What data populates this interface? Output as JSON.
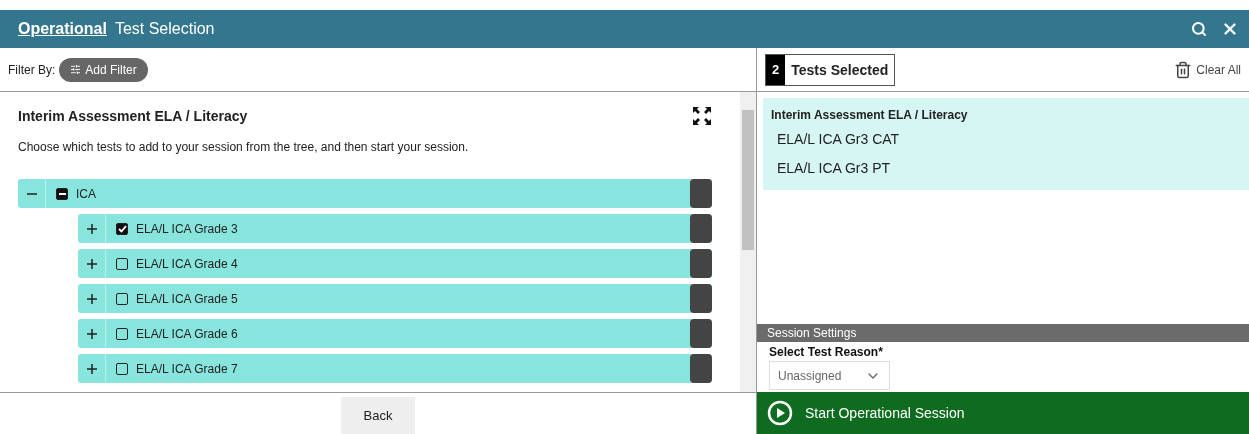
{
  "header": {
    "mode": "Operational",
    "title": "Test Selection"
  },
  "filter": {
    "label": "Filter By:",
    "button": "Add Filter"
  },
  "assessment": {
    "title": "Interim Assessment ELA / Literacy",
    "instructions": "Choose which tests to add to your session from the tree, and then start your session."
  },
  "tree": [
    {
      "label": "ICA",
      "expanded": true,
      "checked": false,
      "indeterminate": true,
      "children": [
        {
          "label": "ELA/L ICA Grade 3",
          "expanded": false,
          "checked": true
        },
        {
          "label": "ELA/L ICA Grade 4",
          "expanded": false,
          "checked": false
        },
        {
          "label": "ELA/L ICA Grade 5",
          "expanded": false,
          "checked": false
        },
        {
          "label": "ELA/L ICA Grade 6",
          "expanded": false,
          "checked": false
        },
        {
          "label": "ELA/L ICA Grade 7",
          "expanded": false,
          "checked": false
        }
      ]
    }
  ],
  "back_button": "Back",
  "selection": {
    "count": "2",
    "label": "Tests Selected",
    "clear": "Clear All",
    "groups": [
      {
        "title": "Interim Assessment ELA / Literacy",
        "tests": [
          "ELA/L ICA Gr3 CAT",
          "ELA/L ICA Gr3 PT"
        ]
      }
    ]
  },
  "session_settings": {
    "title": "Session Settings",
    "reason_label": "Select Test Reason*",
    "reason_value": "Unassigned"
  },
  "start_button": "Start Operational Session"
}
